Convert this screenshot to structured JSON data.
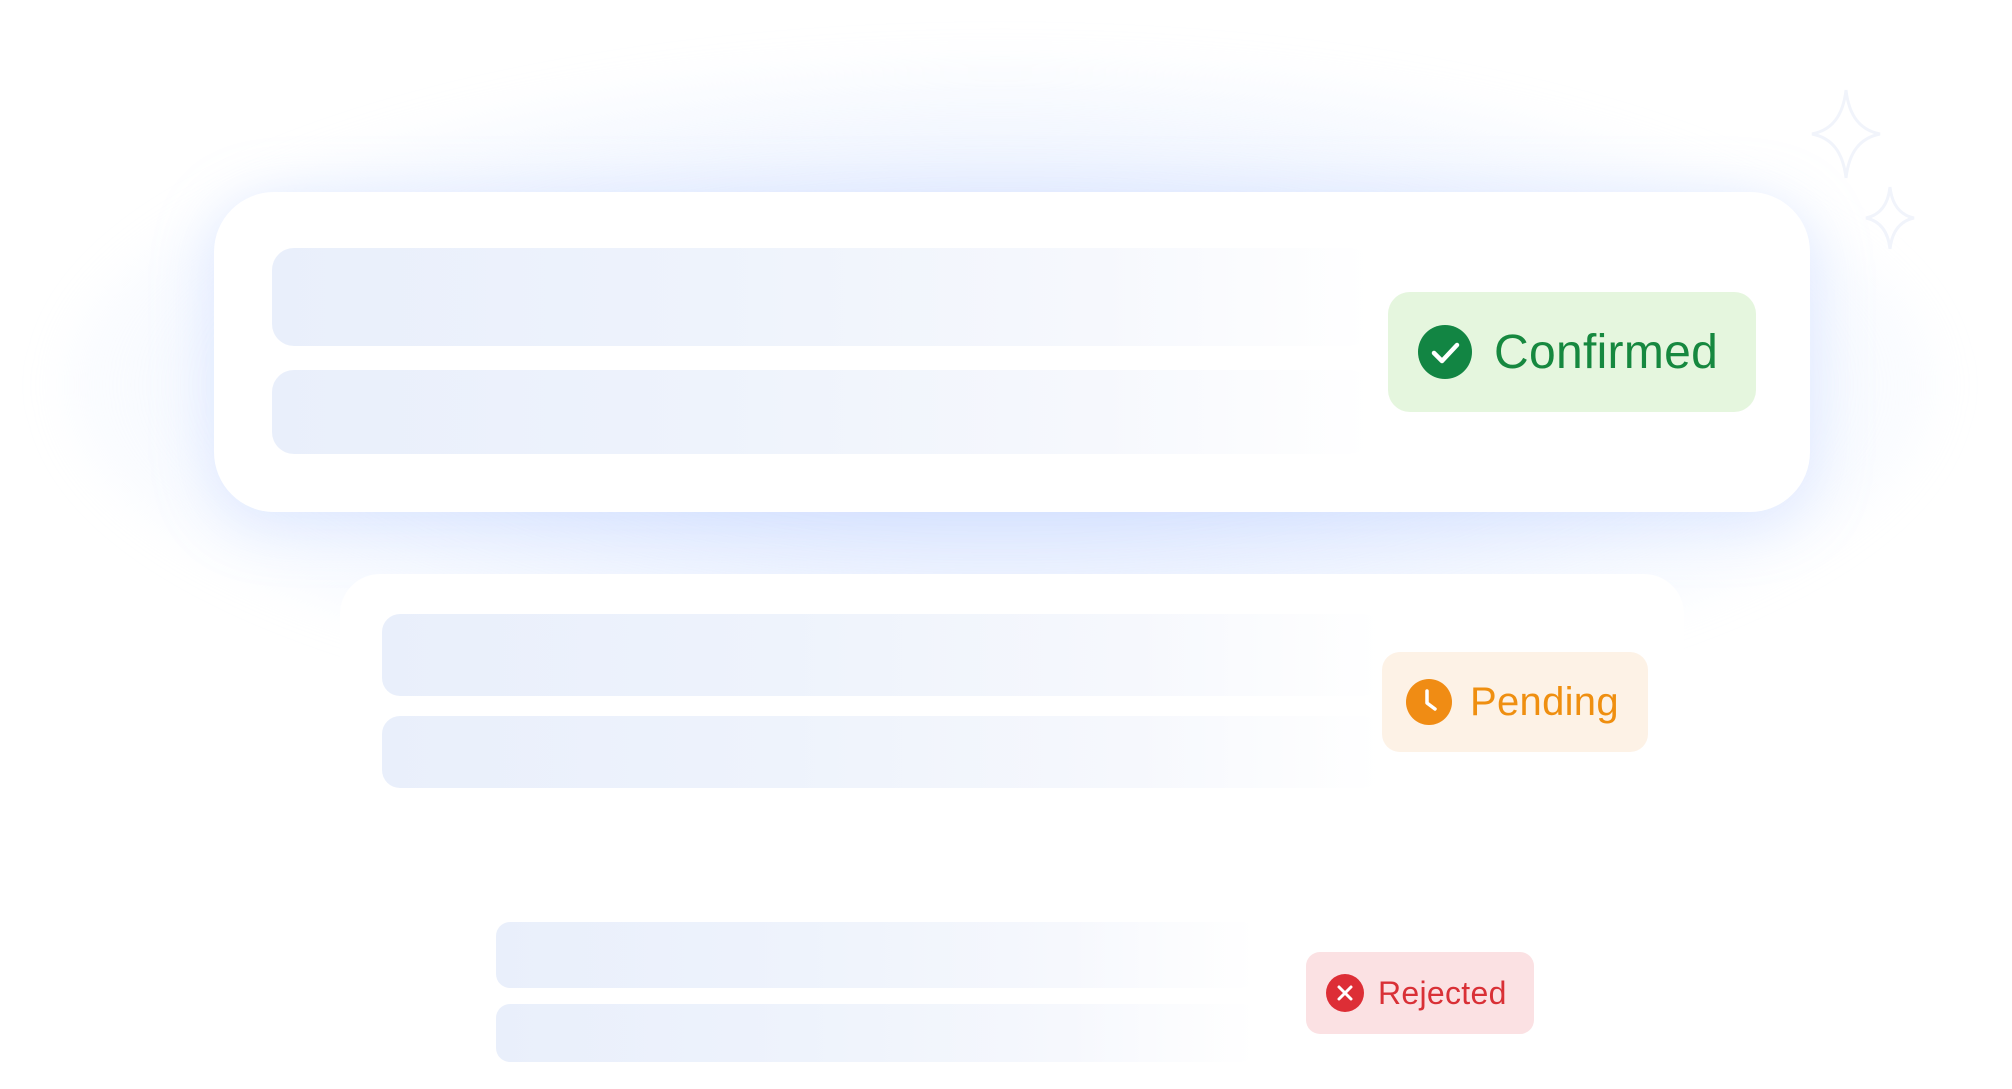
{
  "statuses": {
    "confirmed": {
      "label": "Confirmed",
      "icon": "check-circle-icon",
      "color": "#16883f",
      "background": "#e5f6de"
    },
    "pending": {
      "label": "Pending",
      "icon": "clock-icon",
      "color": "#ef8f10",
      "background": "#fdf2e6"
    },
    "rejected": {
      "label": "Rejected",
      "icon": "x-circle-icon",
      "color": "#d93036",
      "background": "#fbe1e3"
    }
  },
  "decorations": {
    "icons": [
      "sparkle-icon",
      "sparkle-icon"
    ],
    "glow_color": "#c9d9ff",
    "placeholder_color": "#e9effb"
  }
}
